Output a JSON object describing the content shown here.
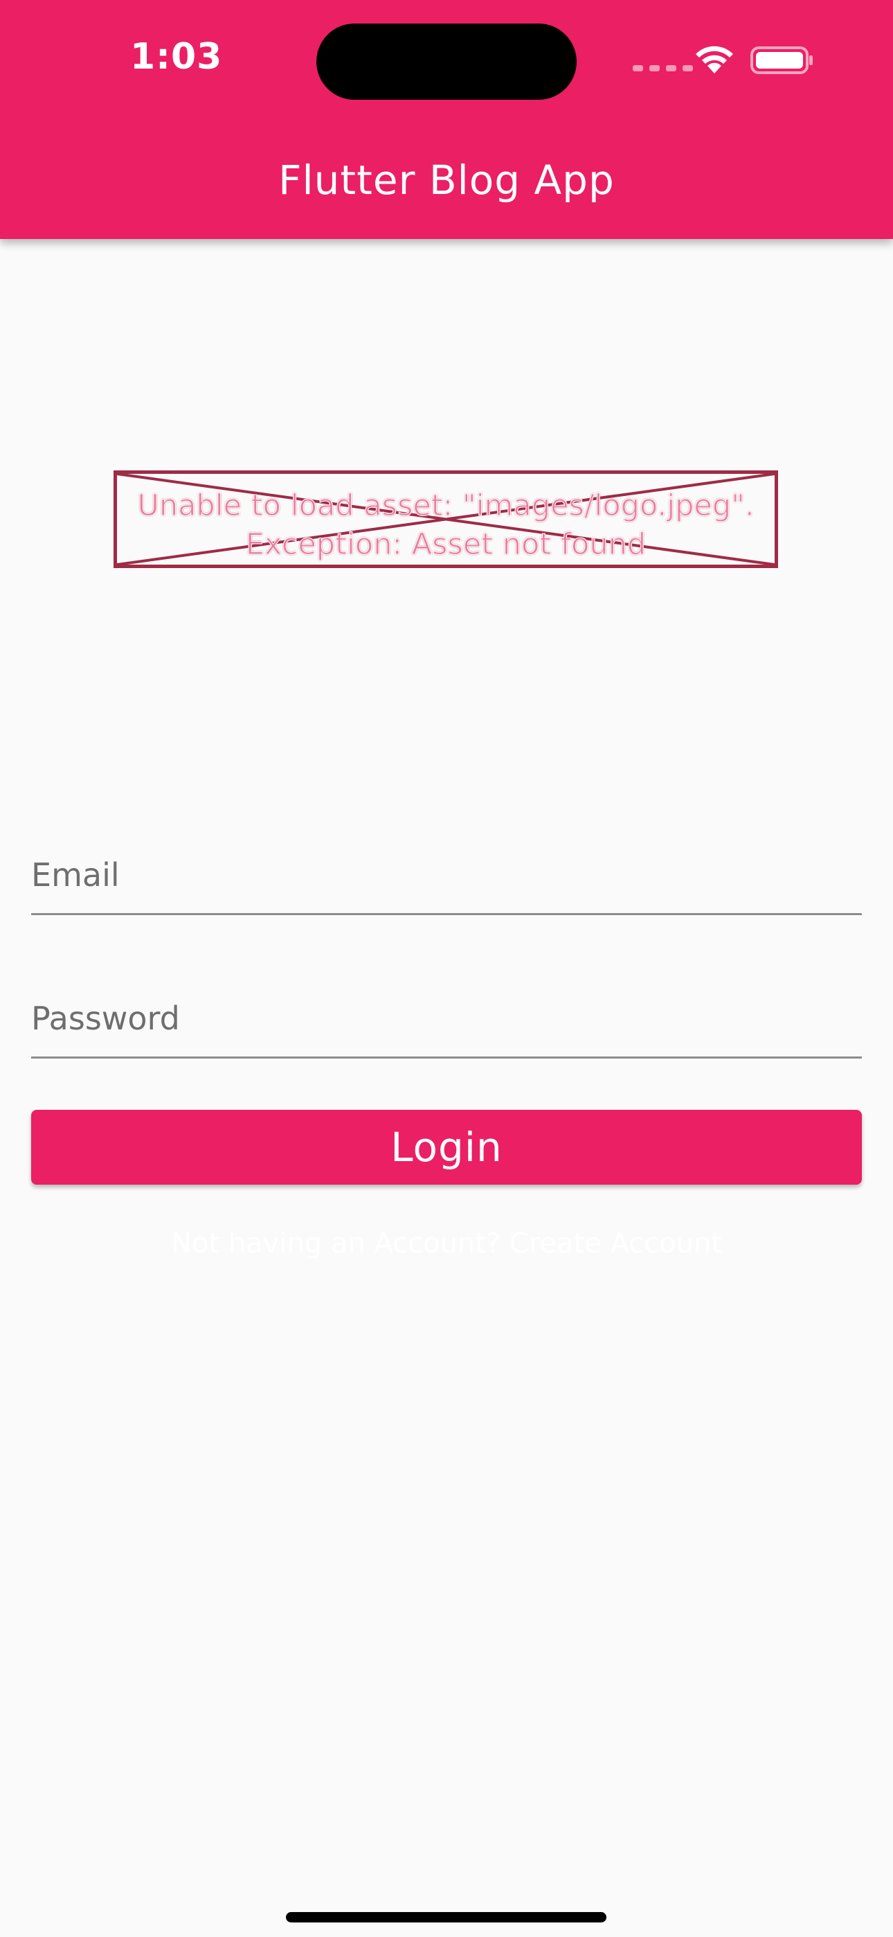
{
  "status_bar": {
    "time": "1:03",
    "wifi_icon": "wifi-icon",
    "battery_icon": "battery-icon",
    "signal_icon": "cellular-signal-icon"
  },
  "app_bar": {
    "title": "Flutter Blog App",
    "background_color": "#eb1f63"
  },
  "logo_error": {
    "message_line1": "Unable to load asset: \"images/logo.jpeg\".",
    "message_line2": "Exception: Asset not found",
    "border_color": "#9f2b46"
  },
  "form": {
    "email": {
      "placeholder": "Email",
      "value": ""
    },
    "password": {
      "placeholder": "Password",
      "value": ""
    },
    "login_label": "Login",
    "create_account_text": "Not having an Account? Create Account"
  },
  "colors": {
    "accent": "#eb1f63",
    "background": "#fafafa"
  }
}
